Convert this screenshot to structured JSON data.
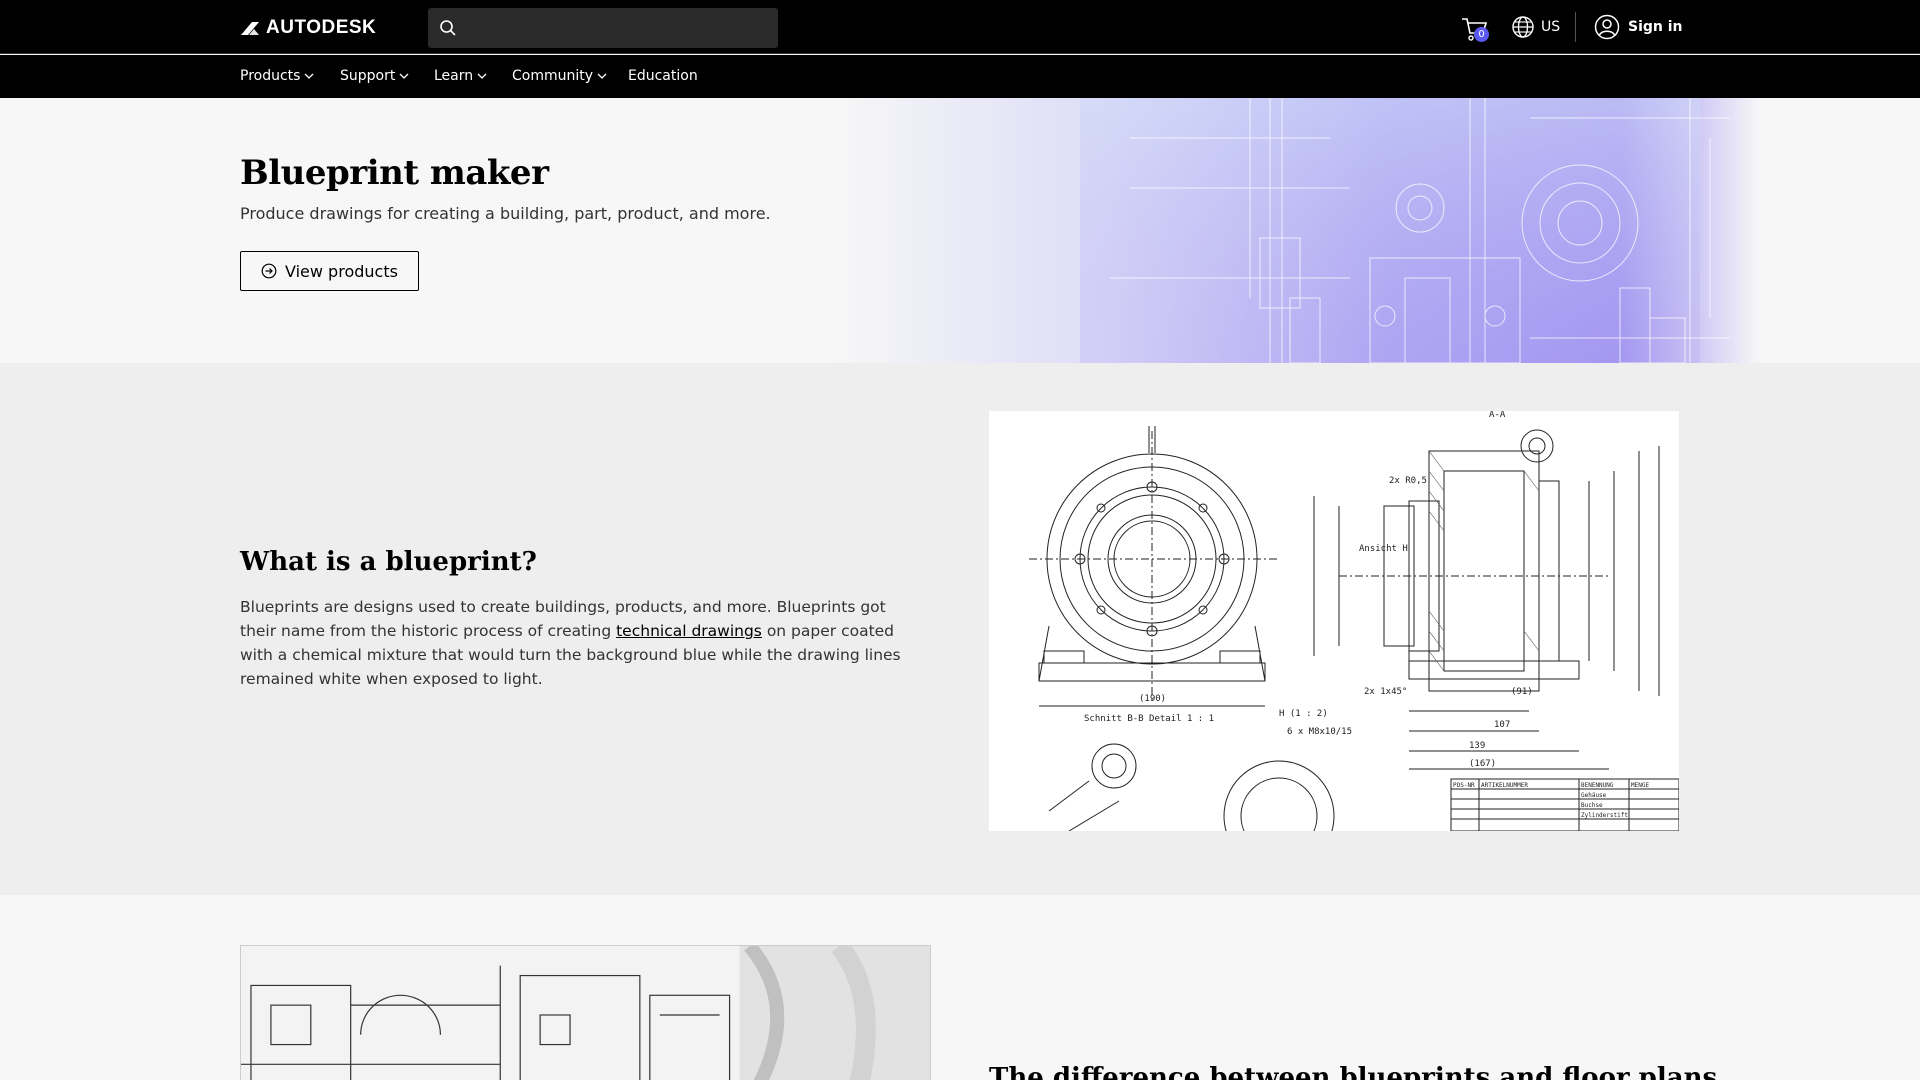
{
  "header": {
    "logo_text": "AUTODESK",
    "search": {
      "placeholder": "",
      "value": ""
    },
    "cart_count": "0",
    "region_label": "US",
    "signin_label": "Sign in"
  },
  "nav": {
    "items": [
      {
        "label": "Products",
        "has_dropdown": true
      },
      {
        "label": "Support",
        "has_dropdown": true
      },
      {
        "label": "Learn",
        "has_dropdown": true
      },
      {
        "label": "Community",
        "has_dropdown": true
      },
      {
        "label": "Education",
        "has_dropdown": false
      }
    ]
  },
  "hero": {
    "title": "Blueprint maker",
    "subtitle": "Produce drawings for creating a building, part, product, and more.",
    "button_label": "View products"
  },
  "what": {
    "title": "What is a blueprint?",
    "body_before": "Blueprints are designs used to create buildings, products, and more. Blueprints got their name from the historic process of creating ",
    "link_text": "technical drawings",
    "body_after": " on paper coated with a chemical mixture that would turn the background blue while the drawing lines remained white when exposed to light.",
    "drawing_labels": [
      "A-A",
      "2x R0,5",
      "Ansicht H",
      "(190)",
      "Schnitt B-B Detail 1 : 1",
      "6 x M8x10/15",
      "139",
      "(167)",
      "107",
      "(91)",
      "2x 1x45°",
      "H (1 : 2)",
      "POS-NR",
      "ARTIKELNUMMER",
      "BENENNUNG",
      "MENGE",
      "Gehäuse",
      "Buchse",
      "Zylinderstift"
    ]
  },
  "floor": {
    "title": "The difference between blueprints and floor plans"
  },
  "colors": {
    "header_bg": "#000000",
    "badge": "#5a5af0",
    "hero_gradient": "#8f86f0"
  }
}
